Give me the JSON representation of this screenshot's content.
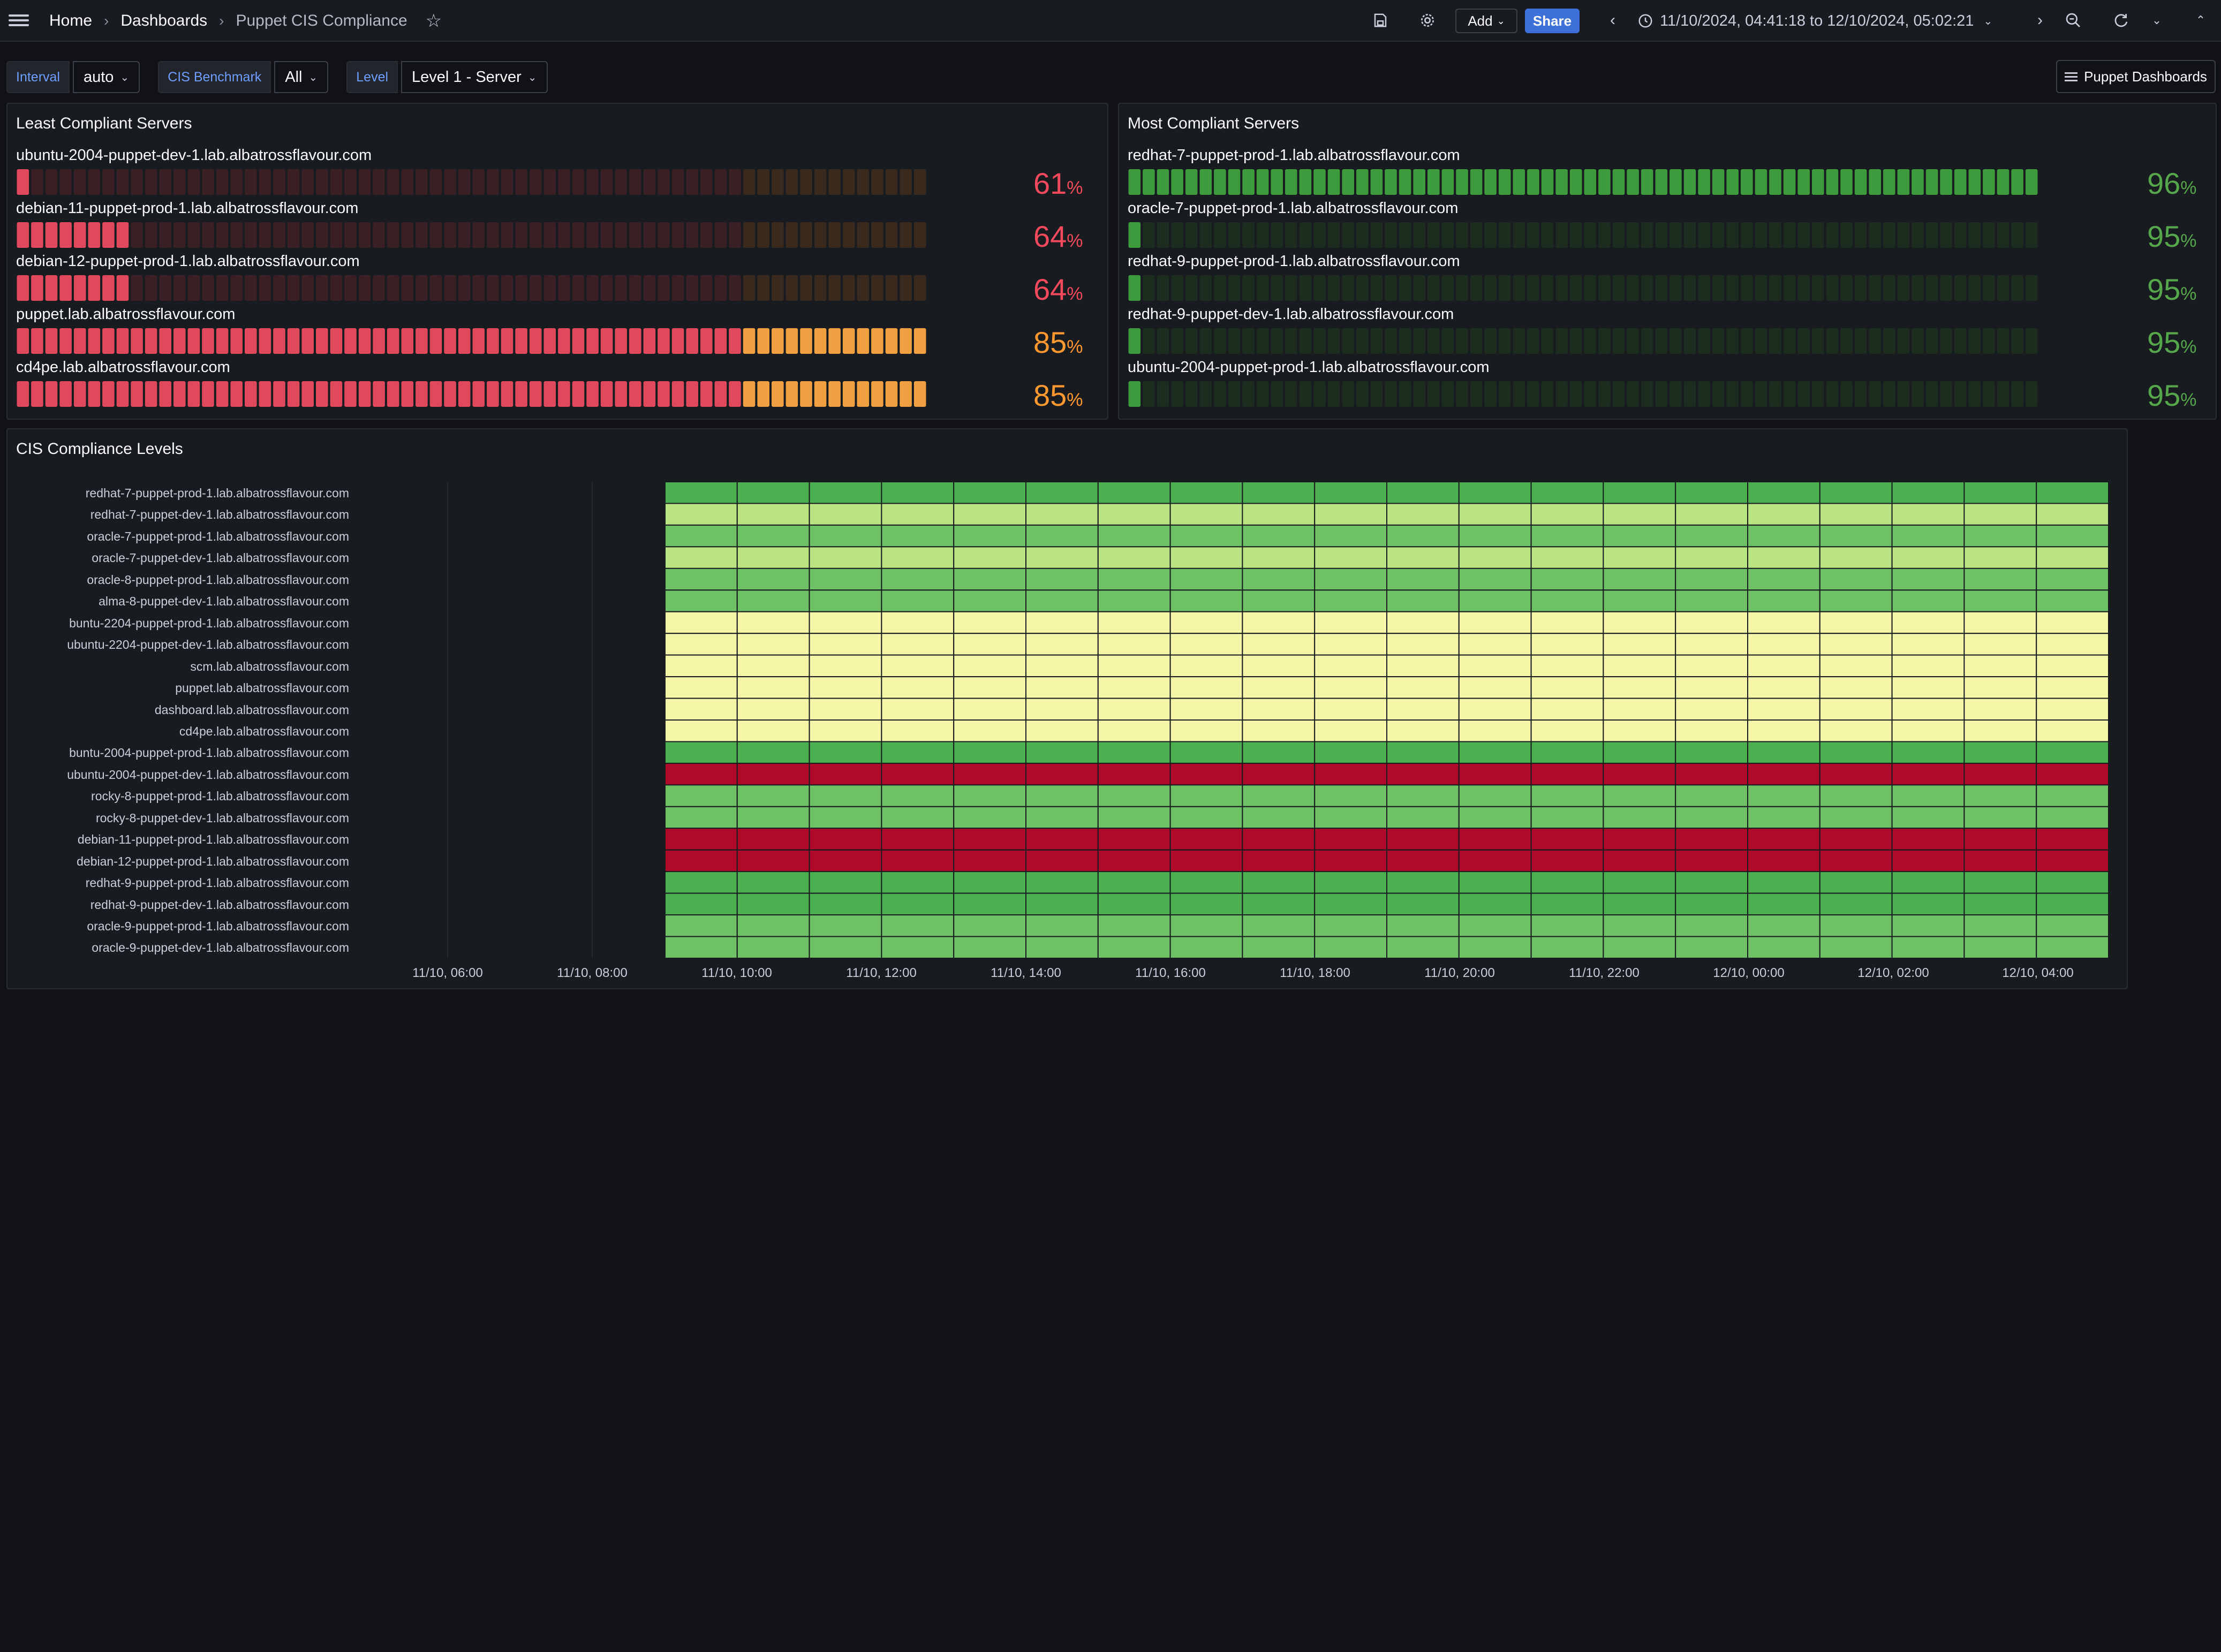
{
  "breadcrumb": {
    "home": "Home",
    "dashboards": "Dashboards",
    "current": "Puppet CIS Compliance"
  },
  "icons": {
    "menu": "hamburger-menu-icon",
    "star": "star-icon",
    "save": "save-icon",
    "settings": "gear-icon",
    "prev": "chevron-left-icon",
    "clock": "clock-icon",
    "next": "chevron-right-icon",
    "zoom_out": "zoom-out-icon",
    "refresh": "refresh-icon",
    "collapse": "chevron-up-icon"
  },
  "toolbar": {
    "add_label": "Add",
    "share_label": "Share",
    "time_range": "11/10/2024, 04:41:18 to 12/10/2024, 05:02:21"
  },
  "variables": [
    {
      "label": "Interval",
      "value": "auto"
    },
    {
      "label": "CIS Benchmark",
      "value": "All"
    },
    {
      "label": "Level",
      "value": "Level 1 - Server"
    }
  ],
  "dashboards_link": "Puppet Dashboards",
  "least_compliant": {
    "title": "Least Compliant Servers",
    "unit": "%",
    "rows": [
      {
        "name": "ubuntu-2004-puppet-dev-1.lab.albatrossflavour.com",
        "value": "61",
        "fill": 0.02
      },
      {
        "name": "debian-11-puppet-prod-1.lab.albatrossflavour.com",
        "value": "64",
        "fill": 0.12
      },
      {
        "name": "debian-12-puppet-prod-1.lab.albatrossflavour.com",
        "value": "64",
        "fill": 0.12
      },
      {
        "name": "puppet.lab.albatrossflavour.com",
        "value": "85",
        "fill": 1.0
      },
      {
        "name": "cd4pe.lab.albatrossflavour.com",
        "value": "85",
        "fill": 1.0
      }
    ]
  },
  "most_compliant": {
    "title": "Most Compliant Servers",
    "unit": "%",
    "rows": [
      {
        "name": "redhat-7-puppet-prod-1.lab.albatrossflavour.com",
        "value": "96",
        "fill": 1.0
      },
      {
        "name": "oracle-7-puppet-prod-1.lab.albatrossflavour.com",
        "value": "95",
        "fill": 0.01
      },
      {
        "name": "redhat-9-puppet-prod-1.lab.albatrossflavour.com",
        "value": "95",
        "fill": 0.01
      },
      {
        "name": "redhat-9-puppet-dev-1.lab.albatrossflavour.com",
        "value": "95",
        "fill": 0.01
      },
      {
        "name": "ubuntu-2004-puppet-prod-1.lab.albatrossflavour.com",
        "value": "95",
        "fill": 0.01
      }
    ]
  },
  "colors": {
    "least_lit": "#e0485c",
    "least_dim": "#3a2024",
    "least_warn_lit": "#f0a040",
    "least_warn_dim": "#3a2a1e",
    "most_lit": "#3d9a3d",
    "most_dim": "#1c2c1e",
    "val_red": "#f2495c",
    "val_orange": "#ff9830",
    "val_green": "#56a64b",
    "hm": {
      "green": "#4caf50",
      "mid": "#6ec165",
      "light": "#b9e481",
      "yellow": "#f5f5a8",
      "red": "#b00a2a"
    }
  },
  "chart_data": {
    "type": "heatmap",
    "title": "CIS Compliance Levels",
    "x": [
      "11/10, 06:00",
      "11/10, 08:00",
      "11/10, 10:00",
      "11/10, 12:00",
      "11/10, 14:00",
      "11/10, 16:00",
      "11/10, 18:00",
      "11/10, 20:00",
      "11/10, 22:00",
      "12/10, 00:00",
      "12/10, 02:00",
      "12/10, 04:00"
    ],
    "columns": 20,
    "rows": [
      {
        "name": "redhat-7-puppet-prod-1.lab.albatrossflavour.com",
        "level": "green"
      },
      {
        "name": "redhat-7-puppet-dev-1.lab.albatrossflavour.com",
        "level": "light"
      },
      {
        "name": "oracle-7-puppet-prod-1.lab.albatrossflavour.com",
        "level": "mid"
      },
      {
        "name": "oracle-7-puppet-dev-1.lab.albatrossflavour.com",
        "level": "light"
      },
      {
        "name": "oracle-8-puppet-prod-1.lab.albatrossflavour.com",
        "level": "mid"
      },
      {
        "name": "alma-8-puppet-dev-1.lab.albatrossflavour.com",
        "level": "mid"
      },
      {
        "name": "buntu-2204-puppet-prod-1.lab.albatrossflavour.com",
        "level": "yellow"
      },
      {
        "name": "ubuntu-2204-puppet-dev-1.lab.albatrossflavour.com",
        "level": "yellow"
      },
      {
        "name": "scm.lab.albatrossflavour.com",
        "level": "yellow"
      },
      {
        "name": "puppet.lab.albatrossflavour.com",
        "level": "yellow"
      },
      {
        "name": "dashboard.lab.albatrossflavour.com",
        "level": "yellow"
      },
      {
        "name": "cd4pe.lab.albatrossflavour.com",
        "level": "yellow"
      },
      {
        "name": "buntu-2004-puppet-prod-1.lab.albatrossflavour.com",
        "level": "green"
      },
      {
        "name": "ubuntu-2004-puppet-dev-1.lab.albatrossflavour.com",
        "level": "red"
      },
      {
        "name": "rocky-8-puppet-prod-1.lab.albatrossflavour.com",
        "level": "mid"
      },
      {
        "name": "rocky-8-puppet-dev-1.lab.albatrossflavour.com",
        "level": "mid"
      },
      {
        "name": "debian-11-puppet-prod-1.lab.albatrossflavour.com",
        "level": "red"
      },
      {
        "name": "debian-12-puppet-prod-1.lab.albatrossflavour.com",
        "level": "red"
      },
      {
        "name": "redhat-9-puppet-prod-1.lab.albatrossflavour.com",
        "level": "green"
      },
      {
        "name": "redhat-9-puppet-dev-1.lab.albatrossflavour.com",
        "level": "green"
      },
      {
        "name": "oracle-9-puppet-prod-1.lab.albatrossflavour.com",
        "level": "mid"
      },
      {
        "name": "oracle-9-puppet-dev-1.lab.albatrossflavour.com",
        "level": "mid"
      }
    ]
  }
}
